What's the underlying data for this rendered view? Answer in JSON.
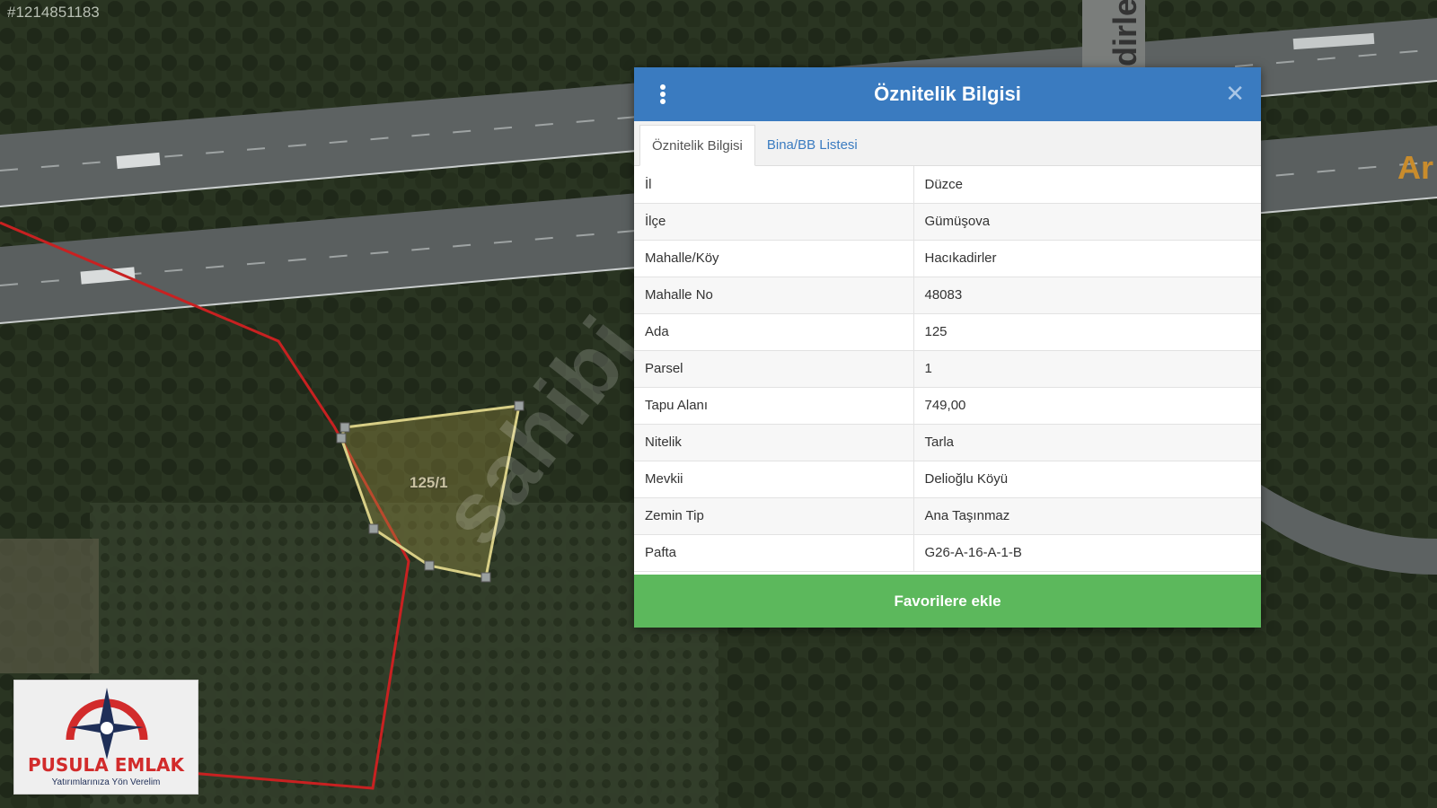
{
  "listing_id": "#1214851183",
  "watermark": "sahibi",
  "map": {
    "parcel_label": "125/1",
    "road_text": "dirler",
    "road_text_2": "Ar"
  },
  "dialog": {
    "title": "Öznitelik Bilgisi",
    "menu_icon": "kebab-menu-icon",
    "close_icon": "close-icon",
    "close_glyph": "✕",
    "tabs": [
      {
        "label": "Öznitelik Bilgisi",
        "active": true
      },
      {
        "label": "Bina/BB Listesi",
        "active": false
      }
    ],
    "rows": [
      {
        "key": "İl",
        "value": "Düzce"
      },
      {
        "key": "İlçe",
        "value": "Gümüşova"
      },
      {
        "key": "Mahalle/Köy",
        "value": "Hacıkadirler"
      },
      {
        "key": "Mahalle No",
        "value": "48083"
      },
      {
        "key": "Ada",
        "value": "125"
      },
      {
        "key": "Parsel",
        "value": "1"
      },
      {
        "key": "Tapu Alanı",
        "value": "749,00"
      },
      {
        "key": "Nitelik",
        "value": "Tarla"
      },
      {
        "key": "Mevkii",
        "value": "Delioğlu Köyü"
      },
      {
        "key": "Zemin Tip",
        "value": "Ana Taşınmaz"
      },
      {
        "key": "Pafta",
        "value": "G26-A-16-A-1-B"
      }
    ],
    "favorite_button": "Favorilere ekle"
  },
  "logo": {
    "name": "PUSULA EMLAK",
    "tagline": "Yatırımlarınıza Yön Verelim",
    "colors": {
      "red": "#d22b2b",
      "navy": "#1f2f58"
    }
  }
}
